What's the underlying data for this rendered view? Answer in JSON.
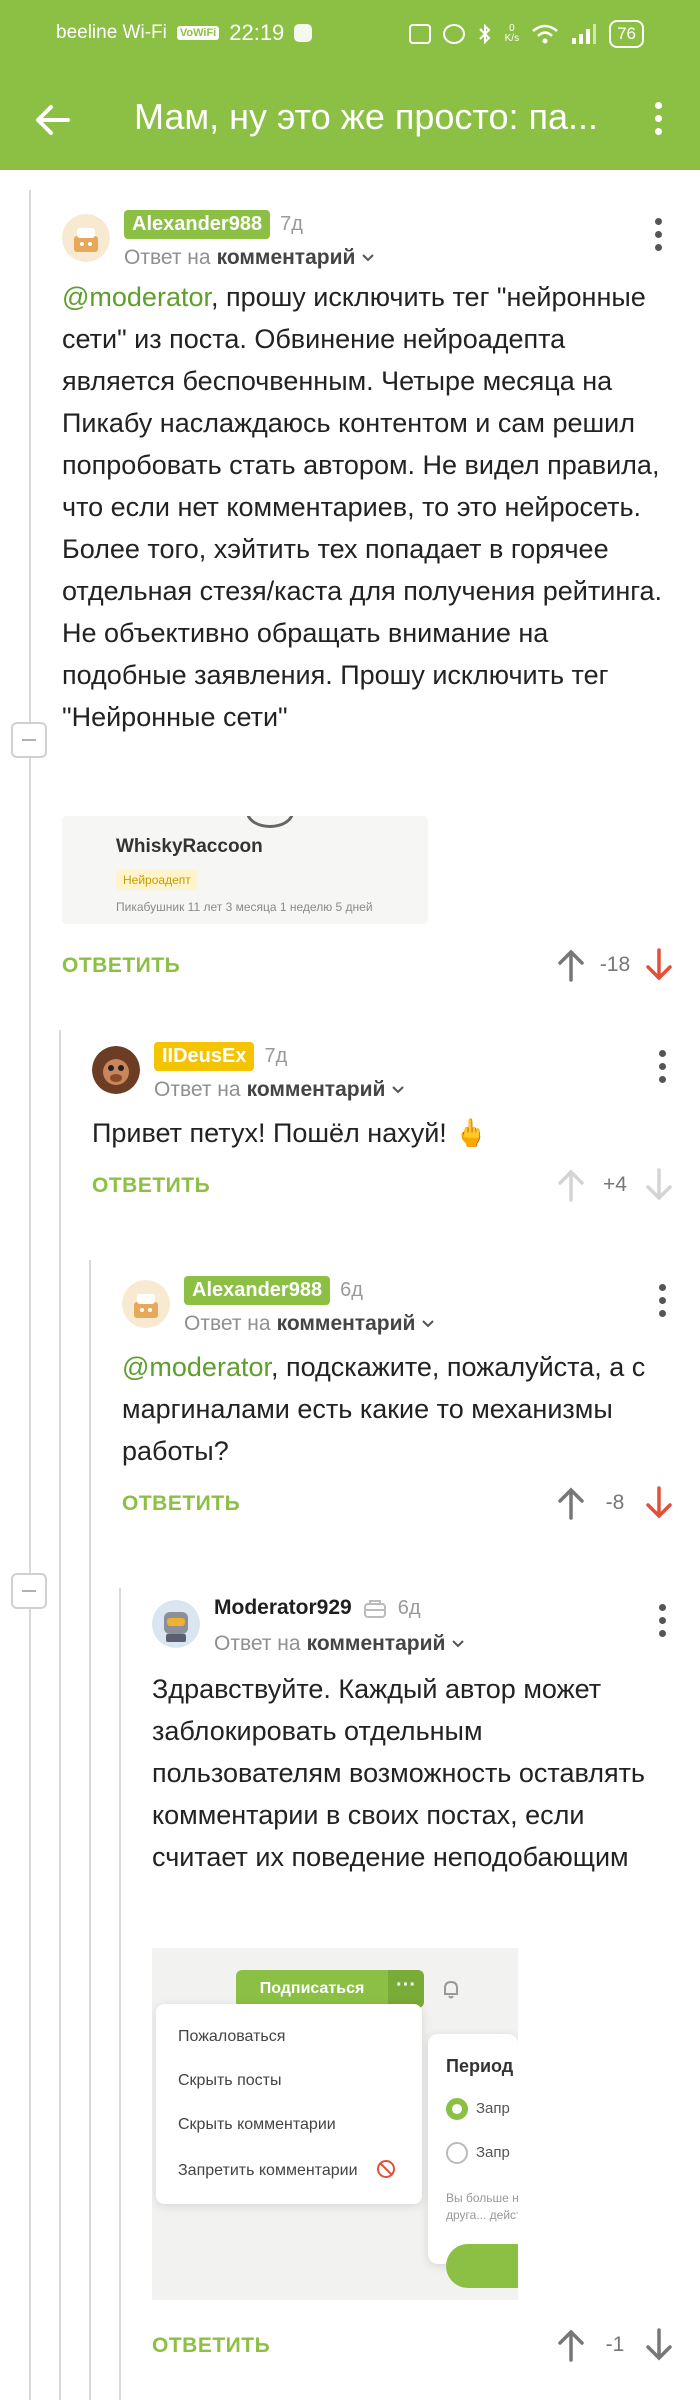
{
  "status_bar": {
    "carrier": "beeline Wi-Fi",
    "vowifi": "VoWiFi",
    "time": "22:19",
    "speed_value": "0",
    "speed_unit": "K/s",
    "battery": "76"
  },
  "app_bar": {
    "title": "Мам, ну это же просто: па..."
  },
  "colors": {
    "brand_green": "#8cc045",
    "mention_green": "#5e9e2c",
    "badge_yellow": "#f5c400",
    "downvote_red": "#e2503a"
  },
  "common": {
    "reply_prefix": "Ответ на",
    "reply_target": "комментарий",
    "reply_button": "ОТВЕТИТЬ"
  },
  "comments": [
    {
      "author": "Alexander988",
      "age": "7д",
      "mention": "@moderator",
      "text": ", прошу исключить тег \"нейронные сети\" из поста. Обвинение нейроадепта является беспочвенным. Четыре месяца на Пикабу наслаждаюсь контентом и сам решил попробовать стать автором. Не видел правила, что если нет комментариев, то это нейросеть. Более того, хэйтить тех попадает в горячее отдельная стезя/каста для получения рейтинга. Не объективно обращать внимание на подобные заявления. Прошу исключить тег \"Нейронные сети\"",
      "embed": {
        "name": "WhiskyRaccoon",
        "tag": "Нейроадепт",
        "meta": "Пикабушник 11 лет 3 месяца 1 неделю 5 дней"
      },
      "score": "-18"
    },
    {
      "author": "IIDeusEx",
      "age": "7д",
      "text": "Привет петух! Пошёл нахуй! 🖕",
      "score": "+4"
    },
    {
      "author": "Alexander988",
      "age": "6д",
      "mention": "@moderator",
      "text": ", подскажите, пожалуйста, а с маргиналами есть какие то механизмы работы?",
      "score": "-8"
    },
    {
      "author": "Moderator929",
      "age": "6д",
      "text": "Здравствуйте. Каждый автор может заблокировать отдельным пользователям возможность оставлять комментарии в своих постах, если считает их поведение неподобающим",
      "screenshot": {
        "subscribe": "Подписаться",
        "more": "···",
        "menu": [
          "Пожаловаться",
          "Скрыть посты",
          "Скрыть комментарии",
          "Запретить комментарии"
        ],
        "period_title": "Период",
        "radio_1": "Запр",
        "radio_2": "Запр",
        "note": "Вы больше не сможете друг друга... действие и..."
      },
      "score": "-1"
    }
  ]
}
